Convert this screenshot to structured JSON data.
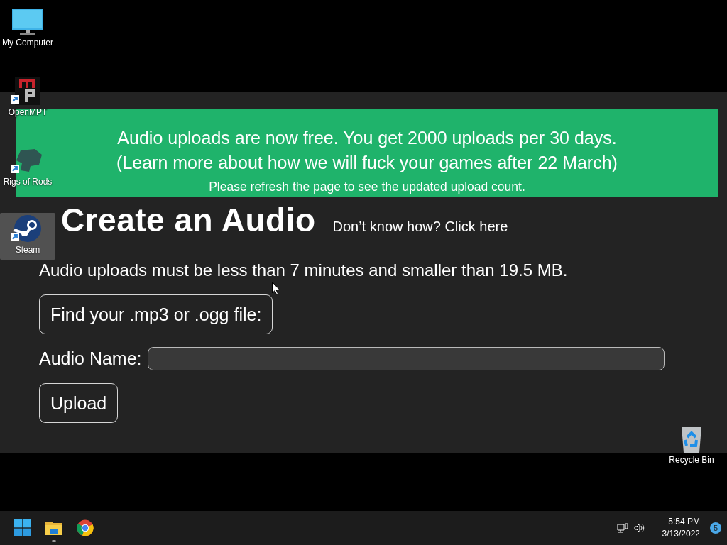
{
  "desktop_icons": [
    {
      "kind": "computer",
      "label": "My Computer",
      "shortcut": false,
      "selected": false
    },
    {
      "kind": "openmpt",
      "label": "OpenMPT",
      "shortcut": true,
      "selected": false
    },
    {
      "kind": "rigs",
      "label": "Rigs of Rods",
      "shortcut": true,
      "selected": false
    },
    {
      "kind": "steam",
      "label": "Steam",
      "shortcut": true,
      "selected": true
    },
    {
      "kind": "recycle",
      "label": "Recycle Bin",
      "shortcut": false,
      "selected": false
    }
  ],
  "page": {
    "banner": {
      "lines": [
        "Audio uploads are now free. You get 2000 uploads per 30 days.",
        "(Learn more about how we will fuck your games after 22 March)"
      ],
      "note": "Please refresh the page to see the updated upload count."
    },
    "heading": "Create an Audio",
    "help_link": "Don’t know how? Click here",
    "size_note": "Audio uploads must be less than 7 minutes and smaller than 19.5 MB.",
    "file_button": "Find your .mp3 or .ogg file:",
    "name_label": "Audio Name:",
    "upload_button": "Upload"
  },
  "taskbar": {
    "apps": [
      {
        "kind": "start",
        "running": false
      },
      {
        "kind": "explorer",
        "running": true
      },
      {
        "kind": "browser",
        "running": false
      }
    ],
    "time": "5:54 PM",
    "date": "3/13/2022",
    "notification_count": "5"
  }
}
